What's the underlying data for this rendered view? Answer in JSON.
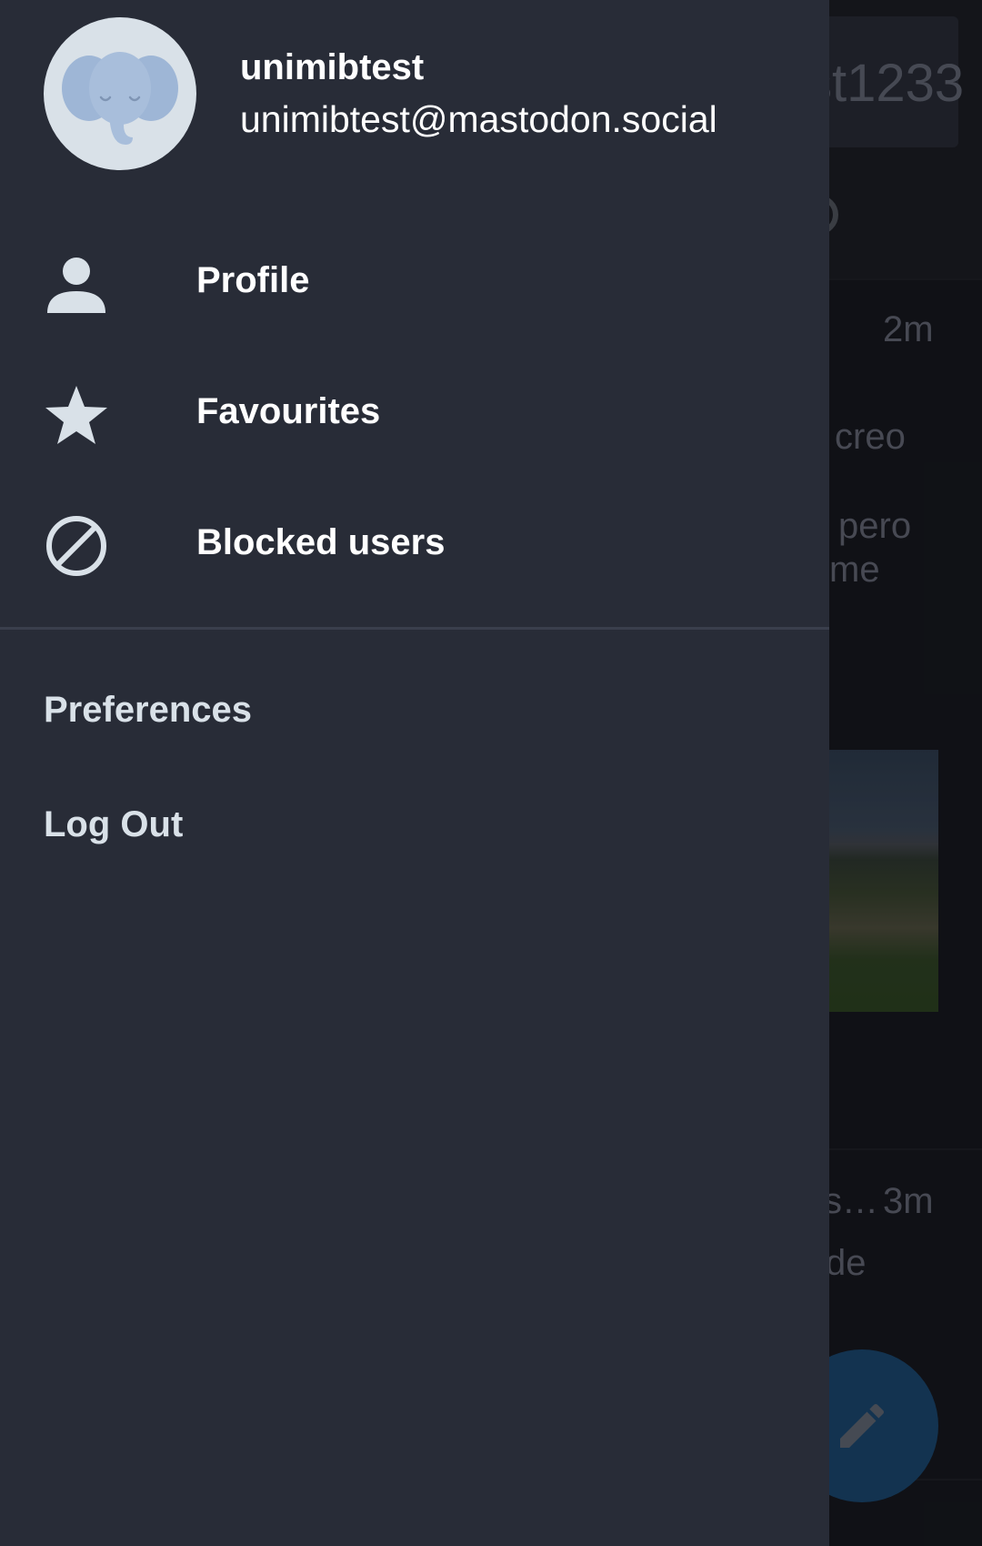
{
  "background": {
    "account_text": "st1233",
    "posts": [
      {
        "time": "2m",
        "lines": [
          "creo",
          "pero",
          "me"
        ]
      },
      {
        "time": "3m",
        "name_fragment": "s…",
        "lines": [
          "de"
        ]
      }
    ],
    "compose_icon": "pencil-icon"
  },
  "drawer": {
    "header": {
      "avatar_icon": "elephant-avatar-icon",
      "username": "unimibtest",
      "handle": "unimibtest@mastodon.social"
    },
    "items": [
      {
        "label": "Profile",
        "icon": "person-icon"
      },
      {
        "label": "Favourites",
        "icon": "star-icon"
      },
      {
        "label": "Blocked users",
        "icon": "block-icon"
      }
    ],
    "secondary_items": [
      {
        "label": "Preferences"
      },
      {
        "label": "Log Out"
      }
    ]
  },
  "colors": {
    "drawer_bg": "#282c37",
    "text_primary": "#ffffff",
    "text_secondary": "#d9e1e8",
    "accent": "#2b90d9"
  }
}
